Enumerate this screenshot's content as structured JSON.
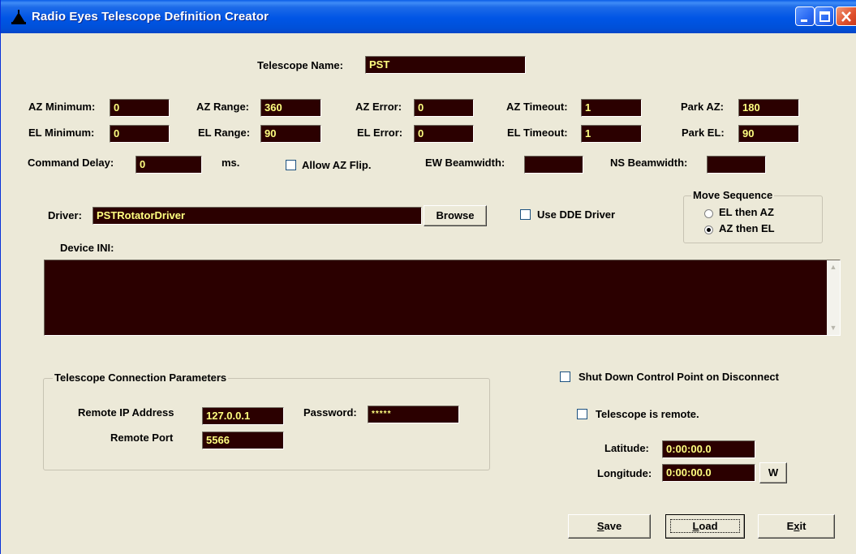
{
  "window": {
    "title": "Radio Eyes Telescope Definition Creator"
  },
  "telescope_name": {
    "label": "Telescope Name:",
    "value": "PST"
  },
  "limits": {
    "az_min": {
      "label": "AZ Minimum:",
      "value": "0"
    },
    "el_min": {
      "label": "EL Minimum:",
      "value": "0"
    },
    "az_range": {
      "label": "AZ Range:",
      "value": "360"
    },
    "el_range": {
      "label": "EL Range:",
      "value": "90"
    },
    "az_error": {
      "label": "AZ Error:",
      "value": "0"
    },
    "el_error": {
      "label": "EL Error:",
      "value": "0"
    },
    "az_timeout": {
      "label": "AZ Timeout:",
      "value": "1"
    },
    "el_timeout": {
      "label": "EL Timeout:",
      "value": "1"
    },
    "park_az": {
      "label": "Park AZ:",
      "value": "180"
    },
    "park_el": {
      "label": "Park EL:",
      "value": "90"
    }
  },
  "command_delay": {
    "label": "Command Delay:",
    "value": "0",
    "unit": "ms."
  },
  "allow_az_flip": {
    "label": "Allow AZ Flip.",
    "checked": false
  },
  "ew_beamwidth": {
    "label": "EW Beamwidth:",
    "value": ""
  },
  "ns_beamwidth": {
    "label": "NS Beamwidth:",
    "value": ""
  },
  "driver": {
    "label": "Driver:",
    "value": "PSTRotatorDriver",
    "browse_label": "Browse"
  },
  "use_dde": {
    "label": "Use DDE Driver",
    "checked": false
  },
  "move_sequence": {
    "title": "Move Sequence",
    "options": [
      {
        "label": "EL then AZ",
        "selected": false
      },
      {
        "label": "AZ then EL",
        "selected": true
      }
    ]
  },
  "device_ini": {
    "label": "Device INI:",
    "value": ""
  },
  "connection": {
    "title": "Telescope Connection Parameters",
    "ip_label": "Remote IP Address",
    "ip_value": "127.0.0.1",
    "password_label": "Password:",
    "password_value": "*****",
    "port_label": "Remote Port",
    "port_value": "5566"
  },
  "shutdown": {
    "label": "Shut Down Control Point on Disconnect",
    "checked": false
  },
  "remote": {
    "label": "Telescope is remote.",
    "checked": false
  },
  "latitude": {
    "label": "Latitude:",
    "value": "0:00:00.0"
  },
  "longitude": {
    "label": "Longitude:",
    "value": "0:00:00.0",
    "hemisphere": "W"
  },
  "buttons": {
    "save": {
      "key": "S",
      "rest": "ave"
    },
    "load": {
      "key": "L",
      "rest": "oad"
    },
    "exit": {
      "pre": "E",
      "key": "x",
      "rest": "it"
    }
  },
  "colors": {
    "field_bg": "#2b0000",
    "field_text": "#ffff80",
    "form_bg": "#ece9d8",
    "titlebar": "#0055e5"
  }
}
